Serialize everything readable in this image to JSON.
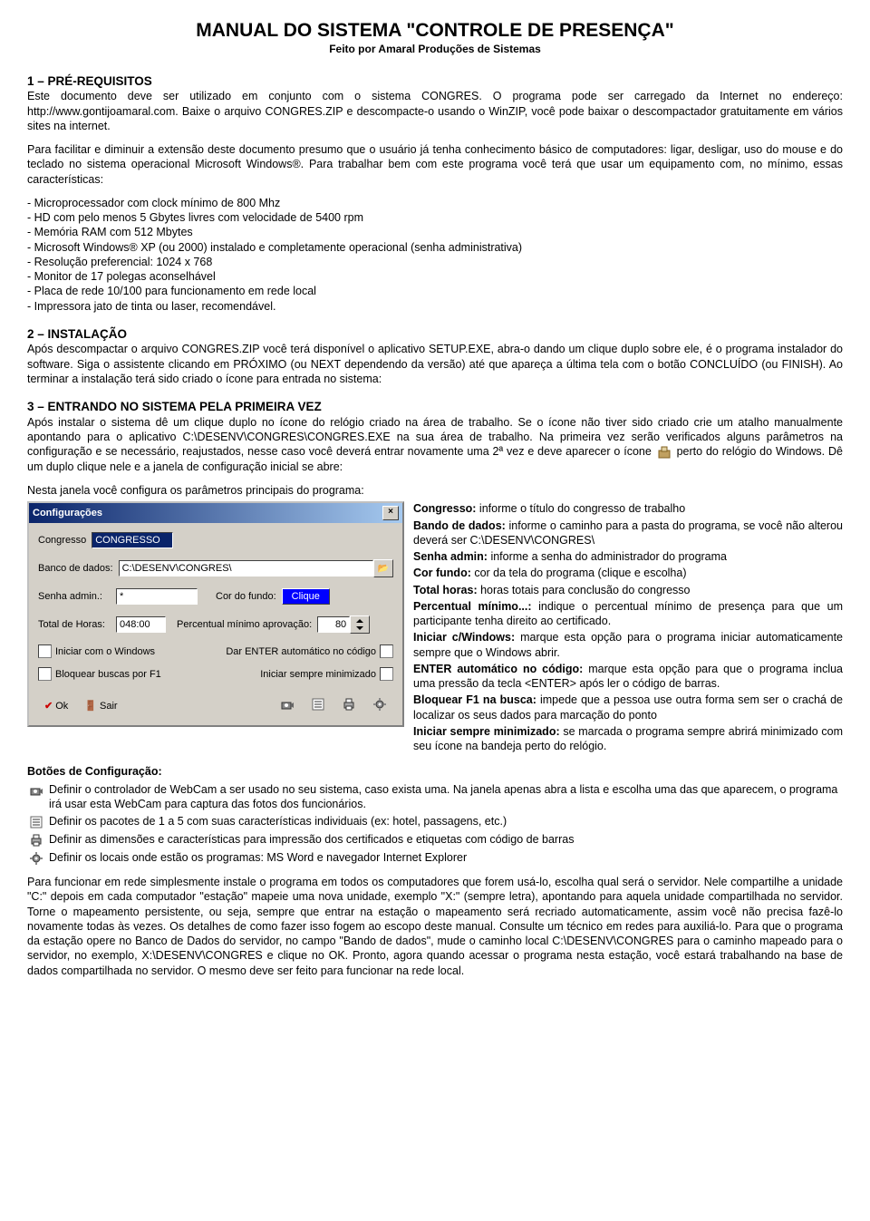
{
  "header": {
    "title": "MANUAL DO SISTEMA \"CONTROLE DE PRESENÇA\"",
    "subtitle": "Feito por Amaral Produções de Sistemas"
  },
  "s1": {
    "heading": "1 – PRÉ-REQUISITOS",
    "p1": "Este documento deve ser utilizado em conjunto com o sistema CONGRES. O programa pode ser carregado da Internet no endereço: http://www.gontijoamaral.com. Baixe o arquivo CONGRES.ZIP e descompacte-o usando o WinZIP, você pode baixar o descompactador gratuitamente em vários sites na internet.",
    "p2": "Para facilitar e diminuir a extensão deste documento presumo que o usuário já tenha conhecimento básico de computadores: ligar, desligar, uso do mouse e do teclado no sistema operacional Microsoft Windows®. Para trabalhar bem com este programa você terá que usar um equipamento com, no mínimo, essas características:",
    "specs": [
      "- Microprocessador com clock mínimo de 800 Mhz",
      "- HD com pelo menos 5 Gbytes livres com velocidade de 5400 rpm",
      "- Memória RAM com 512 Mbytes",
      "- Microsoft Windows® XP (ou 2000) instalado e completamente operacional (senha administrativa)",
      "- Resolução preferencial: 1024 x 768",
      "- Monitor de 17 polegas aconselhável",
      "- Placa de rede 10/100 para funcionamento em rede local",
      "- Impressora jato de tinta ou laser, recomendável."
    ]
  },
  "s2": {
    "heading": "2 – INSTALAÇÃO",
    "p1": "Após descompactar o arquivo CONGRES.ZIP você terá disponível o aplicativo SETUP.EXE, abra-o dando um clique duplo sobre ele, é o programa instalador do software. Siga o assistente clicando em PRÓXIMO (ou NEXT dependendo da versão) até que apareça a última tela com o botão CONCLUÍDO (ou FINISH). Ao terminar a instalação terá sido criado o ícone para entrada no sistema:"
  },
  "s3": {
    "heading": "3 – ENTRANDO NO SISTEMA PELA PRIMEIRA VEZ",
    "p1a": "Após instalar o sistema dê um clique duplo no ícone do relógio criado na área de trabalho. Se o ícone não tiver sido criado crie um atalho manualmente apontando para o aplicativo C:\\DESENV\\CONGRES\\CONGRES.EXE na sua área de trabalho. Na primeira vez serão verificados alguns parâmetros na configuração e se necessário, reajustados, nesse caso você deverá entrar novamente uma 2ª vez e deve aparecer o ícone ",
    "p1b": " perto do relógio do Windows. Dê um duplo clique nele e a janela de configuração inicial se abre:",
    "p2": "Nesta janela você configura os parâmetros principais do programa:"
  },
  "config": {
    "title": "Configurações",
    "lbl_congresso": "Congresso",
    "val_congresso": "CONGRESSO",
    "lbl_banco": "Banco de dados:",
    "val_banco": "C:\\DESENV\\CONGRES\\",
    "lbl_senha": "Senha admin.:",
    "val_senha": "*",
    "lbl_corfundo": "Cor do fundo:",
    "btn_clique": "Clique",
    "lbl_total": "Total de Horas:",
    "val_total": "048:00",
    "lbl_percentual": "Percentual mínimo aprovação:",
    "val_percentual": "80",
    "chk_iniciar_win": "Iniciar com o Windows",
    "chk_enter": "Dar ENTER automático no código",
    "chk_bloquear": "Bloquear buscas por F1",
    "chk_minimizado": "Iniciar sempre minimizado",
    "btn_ok": "Ok",
    "btn_sair": "Sair"
  },
  "desc": {
    "congresso_l": "Congresso:",
    "congresso_t": " informe o título do congresso de trabalho",
    "banco_l": "Bando de dados:",
    "banco_t": " informe o caminho para a pasta do programa, se você não alterou deverá ser C:\\DESENV\\CONGRES\\",
    "senha_l": "Senha admin:",
    "senha_t": " informe a senha do administrador do programa",
    "cor_l": "Cor fundo:",
    "cor_t": " cor da tela do programa (clique e escolha)",
    "total_l": "Total horas:",
    "total_t": " horas totais para conclusão do congresso",
    "perc_l": "Percentual mínimo...:",
    "perc_t": " indique o percentual mínimo de presença para que um participante tenha direito ao certificado.",
    "iniciar_l": "Iniciar c/Windows:",
    "iniciar_t": " marque esta opção para o programa iniciar automaticamente sempre que o Windows abrir.",
    "enter_l": "ENTER automático no código:",
    "enter_t": " marque esta opção para que o programa inclua uma pressão da tecla <ENTER> após ler o código de barras.",
    "bloq_l": "Bloquear F1 na busca:",
    "bloq_t": " impede que a pessoa use outra forma sem ser o crachá de localizar os seus dados para marcação do ponto",
    "min_l": "Iniciar sempre minimizado:",
    "min_t": " se marcada o programa sempre abrirá minimizado com seu ícone na bandeja perto do relógio."
  },
  "btns": {
    "heading": "Botões de Configuração:",
    "d1": "Definir o controlador de WebCam a ser usado no seu sistema, caso exista uma. Na janela apenas abra a lista e escolha uma das que aparecem, o programa irá usar esta WebCam para captura das fotos dos funcionários.",
    "d2": "Definir os pacotes de 1 a 5 com suas características individuais (ex: hotel, passagens, etc.)",
    "d3": "Definir as dimensões e características para impressão dos certificados e etiquetas com código de barras",
    "d4": "Definir os locais onde estão os programas: MS Word e navegador Internet Explorer"
  },
  "footer": {
    "p": "Para funcionar em rede simplesmente instale o programa em todos os computadores que forem usá-lo, escolha qual será o servidor. Nele compartilhe a unidade \"C:\" depois em cada computador \"estação\" mapeie uma nova unidade, exemplo \"X:\" (sempre letra), apontando para aquela unidade compartilhada no servidor. Torne o mapeamento persistente, ou seja, sempre que entrar na estação o mapeamento será recriado automaticamente, assim você não precisa fazê-lo novamente todas às vezes. Os detalhes de como fazer isso fogem ao escopo deste manual. Consulte um técnico em redes para auxiliá-lo. Para que o programa da estação opere no Banco de Dados do servidor, no campo \"Bando de dados\", mude o caminho local C:\\DESENV\\CONGRES para o caminho mapeado para o servidor, no exemplo, X:\\DESENV\\CONGRES e clique no OK. Pronto, agora quando acessar o programa nesta estação, você estará trabalhando na base de dados compartilhada no servidor. O mesmo deve ser feito para funcionar na rede local."
  }
}
